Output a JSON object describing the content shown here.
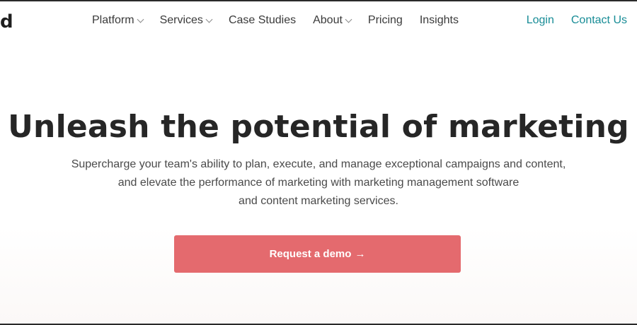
{
  "logo": {
    "text": "d"
  },
  "nav": {
    "items": [
      {
        "label": "Platform",
        "has_dropdown": true
      },
      {
        "label": "Services",
        "has_dropdown": true
      },
      {
        "label": "Case Studies",
        "has_dropdown": false
      },
      {
        "label": "About",
        "has_dropdown": true
      },
      {
        "label": "Pricing",
        "has_dropdown": false
      },
      {
        "label": "Insights",
        "has_dropdown": false
      }
    ],
    "login": "Login",
    "contact": "Contact Us"
  },
  "hero": {
    "title": "Unleash the potential of marketing",
    "subtitle_lines": [
      "Supercharge your team's ability to plan, execute, and manage exceptional campaigns and content,",
      "and elevate the performance of marketing with marketing management software",
      "and content marketing services."
    ],
    "cta_label": "Request a demo",
    "cta_arrow": "→"
  },
  "colors": {
    "accent_link": "#178c96",
    "cta_background": "#e46a6e",
    "text_dark": "#262626"
  }
}
